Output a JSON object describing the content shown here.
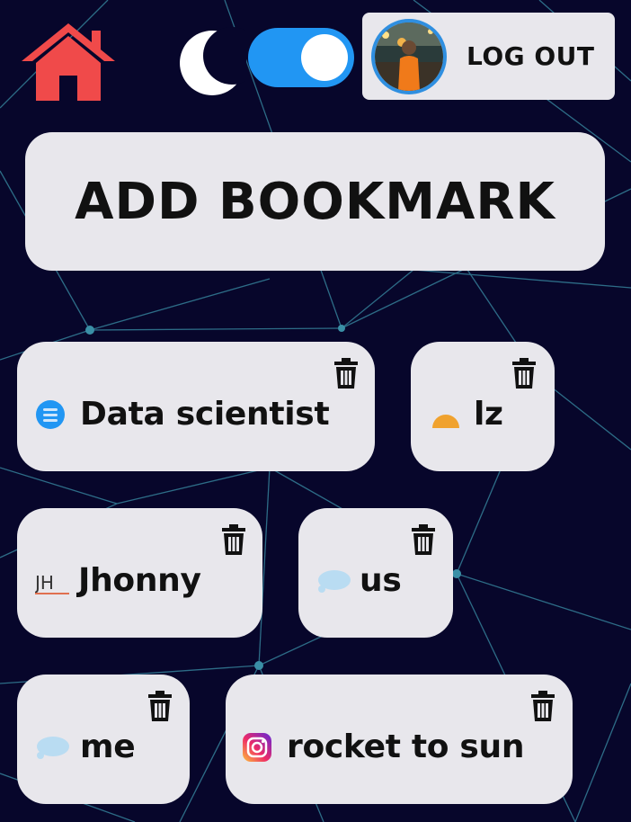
{
  "header": {
    "logout_label": "LOG OUT",
    "theme_toggle_on": true
  },
  "actions": {
    "add_bookmark_label": "ADD BOOKMARK"
  },
  "bookmarks": [
    {
      "label": "Data scientist",
      "favicon": "list-icon"
    },
    {
      "label": "lz",
      "favicon": "half-circle-icon"
    },
    {
      "label": "Jhonny",
      "favicon": "jh-logo-icon"
    },
    {
      "label": "us",
      "favicon": "cloud-icon"
    },
    {
      "label": "me",
      "favicon": "cloud-icon"
    },
    {
      "label": "rocket to sun",
      "favicon": "instagram-icon"
    }
  ],
  "colors": {
    "background": "#07062b",
    "card": "#e8e7ec",
    "accent": "#2196f3",
    "home": "#f04a4a",
    "network_lines": "#3a8fa6"
  }
}
